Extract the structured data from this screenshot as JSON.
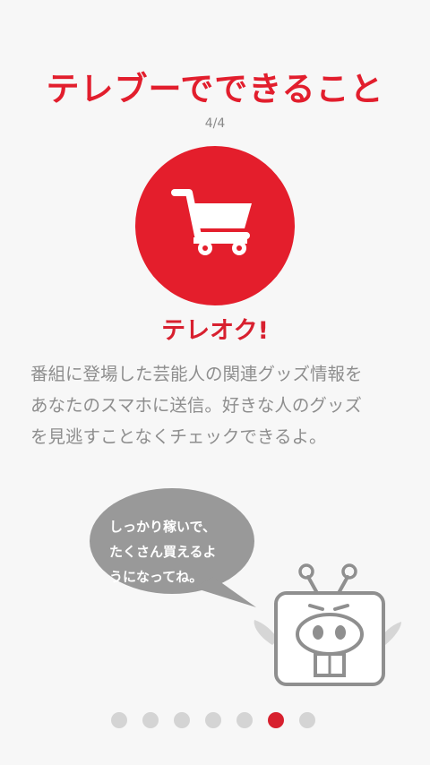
{
  "header": {
    "title": "テレブーでできること",
    "page_count": "4/4"
  },
  "feature": {
    "icon": "shopping-cart-icon",
    "title": "テレオク!",
    "description": "番組に登場した芸能人の関連グッズ情報を\nあなたのスマホに送信。好きな人のグッズ\nを見逃すことなくチェックできるよ。"
  },
  "mascot": {
    "speech": "しっかり稼いで、\nたくさん買えるよ\nうになってね。",
    "icon": "hippo-mascot-icon"
  },
  "pagination": {
    "total": 7,
    "active_index": 5
  },
  "colors": {
    "accent": "#e41e2c",
    "text_gray": "#8e8e8e",
    "bubble_gray": "#999999",
    "dot_inactive": "#d4d4d4"
  }
}
